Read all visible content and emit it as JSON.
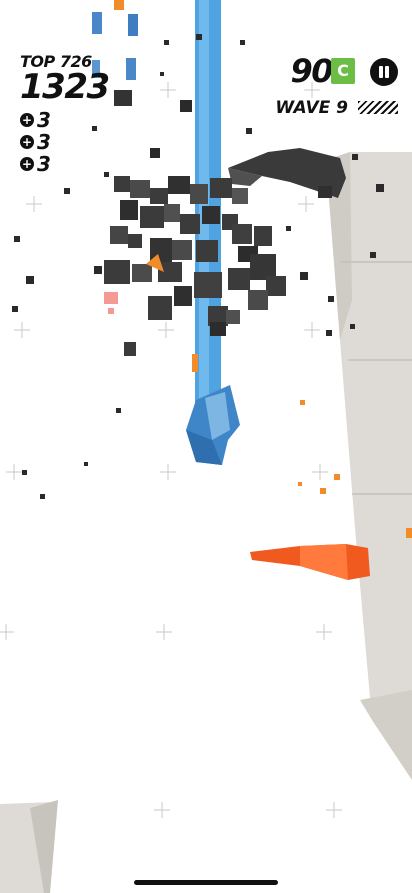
{
  "hud": {
    "top_label": "TOP 726",
    "score": "1323",
    "powerups": [
      {
        "icon": "plus-circle-icon",
        "count": "3"
      },
      {
        "icon": "plus-circle-icon",
        "count": "3"
      },
      {
        "icon": "plus-circle-icon",
        "count": "3"
      }
    ],
    "coins": "90",
    "coin_badge": "C",
    "wave_label": "WAVE 9",
    "pause_icon": "pause-icon"
  },
  "colors": {
    "laser_blue": "#3a8fd6",
    "cube_dark": "#3a3a3a",
    "enemy_orange": "#f05a1e",
    "coin_green": "#6cbd45",
    "wall_gray": "#dedbd6"
  }
}
